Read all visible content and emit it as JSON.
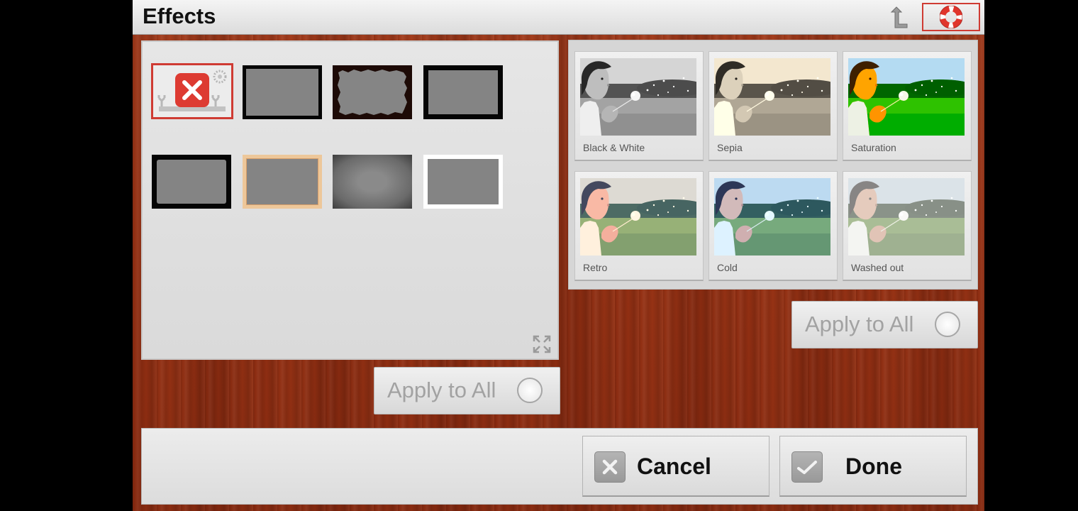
{
  "header": {
    "title": "Effects",
    "back_icon": "back-arrow-icon",
    "help_icon": "lifebuoy-icon"
  },
  "frames_panel": {
    "selected_frame": "no-frame",
    "expand_icon": "expand-icon",
    "frames": [
      "no-frame",
      "black-frame",
      "grunge-frame",
      "thick-black-frame",
      "rounded-black-frame",
      "tan-frame",
      "vignette-frame",
      "white-frame"
    ],
    "apply_all": {
      "label": "Apply to All",
      "checked": false
    }
  },
  "effects_panel": {
    "effects": [
      {
        "label": "Black & White"
      },
      {
        "label": "Sepia"
      },
      {
        "label": "Saturation"
      },
      {
        "label": "Retro"
      },
      {
        "label": "Cold"
      },
      {
        "label": "Washed out"
      }
    ],
    "apply_all": {
      "label": "Apply to All",
      "checked": false
    }
  },
  "footer": {
    "cancel_label": "Cancel",
    "done_label": "Done",
    "cancel_icon": "x-icon",
    "done_icon": "checkmark-icon"
  },
  "colors": {
    "selected_border": "#cf3b33",
    "wood": "#9b3516"
  }
}
